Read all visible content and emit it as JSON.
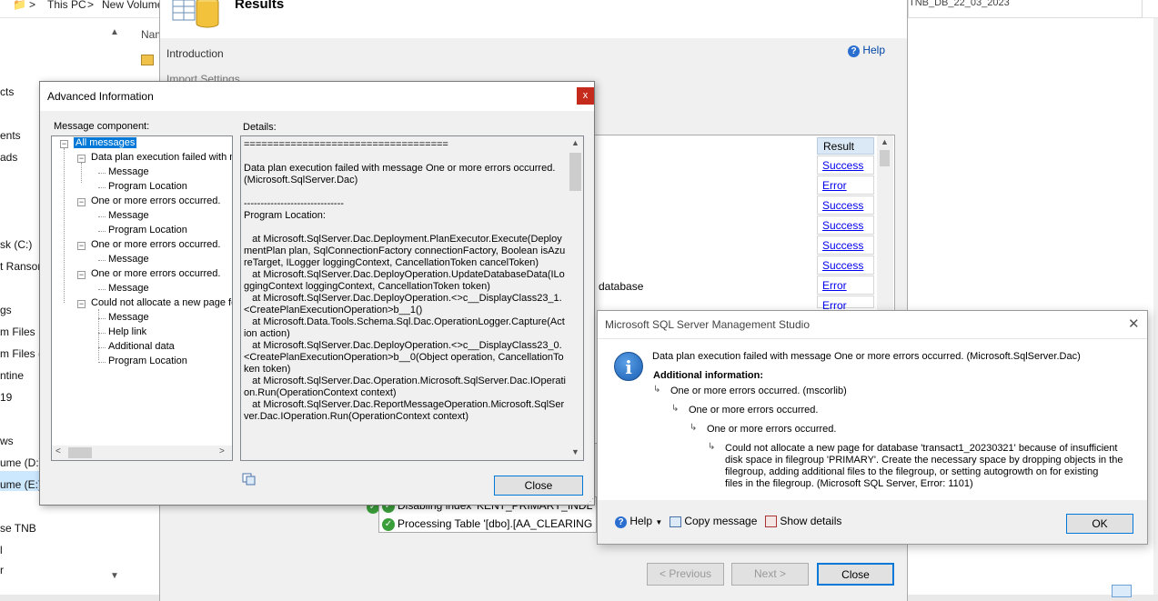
{
  "explorer": {
    "breadcrumb_1": "This PC",
    "breadcrumb_sep": ">",
    "breadcrumb_2": "New Volume",
    "right_path": "TNB_DB_22_03_2023",
    "col_name": "Nam",
    "nav": [
      "cts",
      "ents",
      "ads",
      "sk (C:)",
      "t Ransom",
      "gs",
      "m Files",
      "m Files (",
      "ntine",
      "19",
      "ws",
      "ume (D:)",
      "ume (E:)",
      "se TNB",
      "l",
      "r"
    ]
  },
  "wizard": {
    "title": "Results",
    "steps": [
      "Introduction",
      "Import Settings"
    ],
    "help": "Help",
    "result_header": "Result",
    "results": [
      "Success",
      "Error",
      "Success",
      "Success",
      "Success",
      "Success",
      "Error",
      "Error"
    ],
    "action_fragment": "database",
    "bottom_rows": [
      "Disabling index 'KENT_PRIMARY_INDEX'.",
      "Processing Table '[dbo].[AA_CLEARING]'."
    ],
    "btn_previous": "< Previous",
    "btn_next": "Next >",
    "btn_close": "Close"
  },
  "advanced": {
    "title": "Advanced Information",
    "close_x": "x",
    "component_label": "Message component:",
    "details_label": "Details:",
    "tree": {
      "root": "All messages",
      "n1": "Data plan execution failed with m",
      "n1a": "Message",
      "n1b": "Program Location",
      "n2": "One or more errors occurred.",
      "n2a": "Message",
      "n2b": "Program Location",
      "n3": "One or more errors occurred.",
      "n3a": "Message",
      "n4": "One or more errors occurred.",
      "n4a": "Message",
      "n5": "Could not allocate a new page fo",
      "n5a": "Message",
      "n5b": "Help link",
      "n5c": "Additional data",
      "n5d": "Program Location"
    },
    "details": "===================================\n\nData plan execution failed with message One or more errors occurred. (Microsoft.SqlServer.Dac)\n\n------------------------------\nProgram Location:\n\n   at Microsoft.SqlServer.Dac.Deployment.PlanExecutor.Execute(DeploymentPlan plan, SqlConnectionFactory connectionFactory, Boolean isAzureTarget, ILogger loggingContext, CancellationToken cancelToken)\n   at Microsoft.SqlServer.Dac.DeployOperation.UpdateDatabaseData(ILoggingContext loggingContext, CancellationToken token)\n   at Microsoft.SqlServer.Dac.DeployOperation.<>c__DisplayClass23_1.<CreatePlanExecutionOperation>b__1()\n   at Microsoft.Data.Tools.Schema.Sql.Dac.OperationLogger.Capture(Action action)\n   at Microsoft.SqlServer.Dac.DeployOperation.<>c__DisplayClass23_0.<CreatePlanExecutionOperation>b__0(Object operation, CancellationToken token)\n   at Microsoft.SqlServer.Dac.Operation.Microsoft.SqlServer.Dac.IOperation.Run(OperationContext context)\n   at Microsoft.SqlServer.Dac.ReportMessageOperation.Microsoft.SqlServer.Dac.IOperation.Run(OperationContext context)",
    "close": "Close"
  },
  "msgbox": {
    "title": "Microsoft SQL Server Management Studio",
    "close_x": "✕",
    "main": "Data plan execution failed with message One or more errors occurred. (Microsoft.SqlServer.Dac)",
    "additional": "Additional information:",
    "l1": "One or more errors occurred. (mscorlib)",
    "l2": "One or more errors occurred.",
    "l3": "One or more errors occurred.",
    "l4a": "Could not allocate a new page for database 'transact1_20230321' because of insufficient",
    "l4b": "disk space in filegroup 'PRIMARY'. Create the necessary space by dropping objects in the",
    "l4c": "filegroup, adding additional files to the filegroup, or setting autogrowth on for existing",
    "l4d": "files in the filegroup. (Microsoft SQL Server, Error: 1101)",
    "help": "Help",
    "copy": "Copy message",
    "show": "Show details",
    "ok": "OK"
  }
}
